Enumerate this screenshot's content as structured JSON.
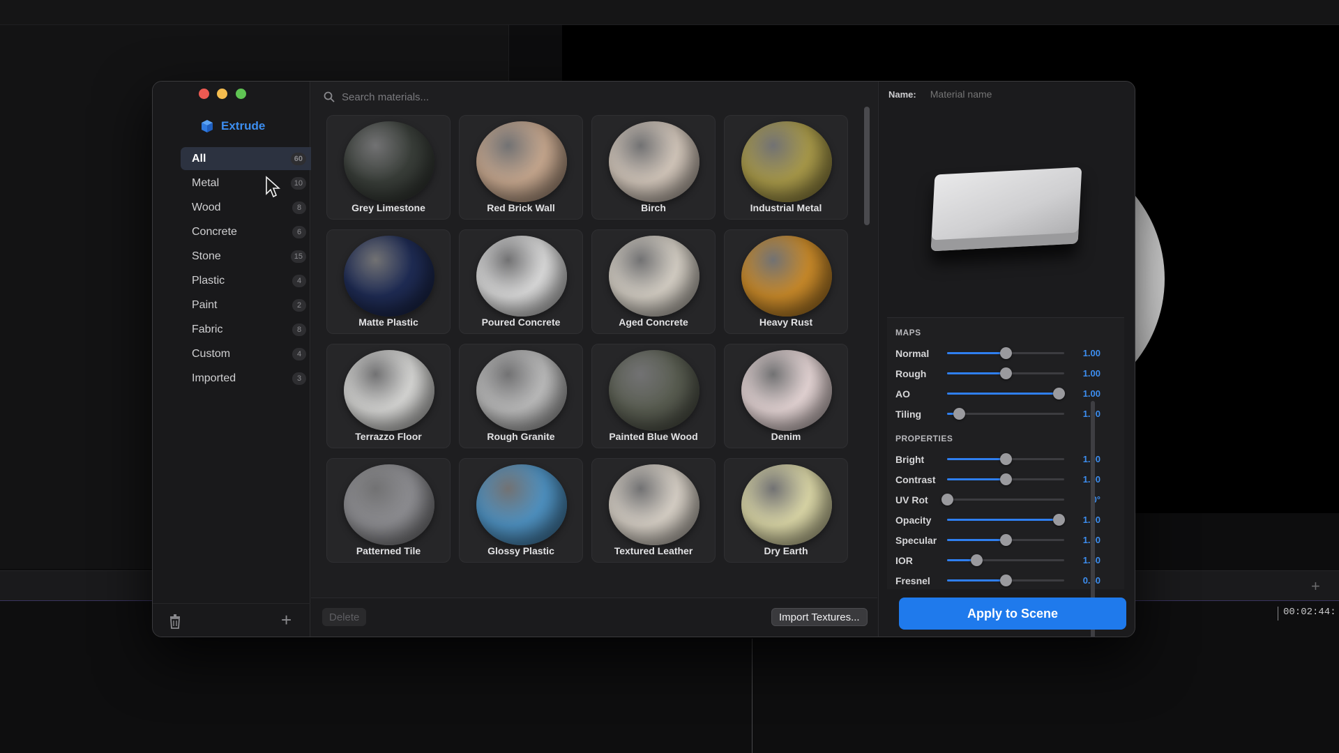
{
  "app": {
    "name": "Extrude",
    "accent": "#3d8ef0"
  },
  "search": {
    "placeholder": "Search materials..."
  },
  "categories": [
    {
      "label": "All",
      "count": "60",
      "active": true
    },
    {
      "label": "Metal",
      "count": "10"
    },
    {
      "label": "Wood",
      "count": "8"
    },
    {
      "label": "Concrete",
      "count": "6"
    },
    {
      "label": "Stone",
      "count": "15"
    },
    {
      "label": "Plastic",
      "count": "4"
    },
    {
      "label": "Paint",
      "count": "2"
    },
    {
      "label": "Fabric",
      "count": "8"
    },
    {
      "label": "Custom",
      "count": "4"
    },
    {
      "label": "Imported",
      "count": "3"
    }
  ],
  "materials": [
    {
      "label": "Grey Limestone",
      "color": "#3a3f3a"
    },
    {
      "label": "Red Brick Wall",
      "color": "#c7a88f"
    },
    {
      "label": "Birch",
      "color": "#d4c8bc"
    },
    {
      "label": "Industrial Metal",
      "color": "#a99a4a"
    },
    {
      "label": "Matte Plastic",
      "color": "#1f2c55"
    },
    {
      "label": "Poured Concrete",
      "color": "#dcdcdc"
    },
    {
      "label": "Aged Concrete",
      "color": "#d6d0c6"
    },
    {
      "label": "Heavy Rust",
      "color": "#c98a2a"
    },
    {
      "label": "Terrazzo Floor",
      "color": "#d8d8d6"
    },
    {
      "label": "Rough Granite",
      "color": "#bdbdbd"
    },
    {
      "label": "Painted Blue Wood",
      "color": "#5a5e52"
    },
    {
      "label": "Denim",
      "color": "#e6d6d6"
    },
    {
      "label": "Patterned Tile",
      "color": "#8e8e92"
    },
    {
      "label": "Glossy Plastic",
      "color": "#4f92c2"
    },
    {
      "label": "Textured Leather",
      "color": "#d9d2c8"
    },
    {
      "label": "Dry Earth",
      "color": "#dcd8a8"
    }
  ],
  "inspector": {
    "name_label": "Name:",
    "name_placeholder": "Material name",
    "maps_title": "MAPS",
    "maps": [
      {
        "label": "Normal",
        "value": "1.00",
        "level": 0.5
      },
      {
        "label": "Rough",
        "value": "1.00",
        "level": 0.5
      },
      {
        "label": "AO",
        "value": "1.00",
        "level": 0.95
      },
      {
        "label": "Tiling",
        "value": "1.00",
        "level": 0.1
      }
    ],
    "properties_title": "PROPERTIES",
    "properties": [
      {
        "label": "Bright",
        "value": "1.00",
        "level": 0.5
      },
      {
        "label": "Contrast",
        "value": "1.00",
        "level": 0.5
      },
      {
        "label": "UV Rot",
        "value": "0°",
        "level": 0.0
      },
      {
        "label": "Opacity",
        "value": "1.00",
        "level": 0.95
      },
      {
        "label": "Specular",
        "value": "1.00",
        "level": 0.5
      },
      {
        "label": "IOR",
        "value": "1.50",
        "level": 0.25
      },
      {
        "label": "Fresnel",
        "value": "0.50",
        "level": 0.5
      }
    ]
  },
  "footer": {
    "delete_label": "Delete",
    "import_label": "Import Textures...",
    "apply_label": "Apply to Scene"
  },
  "host": {
    "timecode": "00:02:44:"
  }
}
